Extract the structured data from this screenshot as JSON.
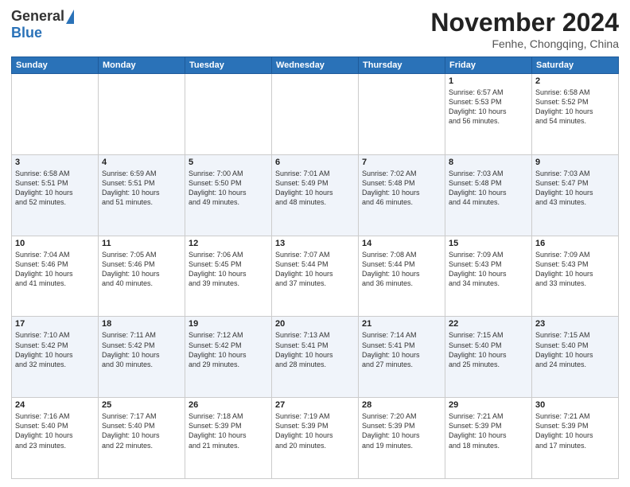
{
  "header": {
    "logo_general": "General",
    "logo_blue": "Blue",
    "month_title": "November 2024",
    "location": "Fenhe, Chongqing, China"
  },
  "calendar": {
    "days_of_week": [
      "Sunday",
      "Monday",
      "Tuesday",
      "Wednesday",
      "Thursday",
      "Friday",
      "Saturday"
    ],
    "weeks": [
      [
        {
          "day": "",
          "info": ""
        },
        {
          "day": "",
          "info": ""
        },
        {
          "day": "",
          "info": ""
        },
        {
          "day": "",
          "info": ""
        },
        {
          "day": "",
          "info": ""
        },
        {
          "day": "1",
          "info": "Sunrise: 6:57 AM\nSunset: 5:53 PM\nDaylight: 10 hours\nand 56 minutes."
        },
        {
          "day": "2",
          "info": "Sunrise: 6:58 AM\nSunset: 5:52 PM\nDaylight: 10 hours\nand 54 minutes."
        }
      ],
      [
        {
          "day": "3",
          "info": "Sunrise: 6:58 AM\nSunset: 5:51 PM\nDaylight: 10 hours\nand 52 minutes."
        },
        {
          "day": "4",
          "info": "Sunrise: 6:59 AM\nSunset: 5:51 PM\nDaylight: 10 hours\nand 51 minutes."
        },
        {
          "day": "5",
          "info": "Sunrise: 7:00 AM\nSunset: 5:50 PM\nDaylight: 10 hours\nand 49 minutes."
        },
        {
          "day": "6",
          "info": "Sunrise: 7:01 AM\nSunset: 5:49 PM\nDaylight: 10 hours\nand 48 minutes."
        },
        {
          "day": "7",
          "info": "Sunrise: 7:02 AM\nSunset: 5:48 PM\nDaylight: 10 hours\nand 46 minutes."
        },
        {
          "day": "8",
          "info": "Sunrise: 7:03 AM\nSunset: 5:48 PM\nDaylight: 10 hours\nand 44 minutes."
        },
        {
          "day": "9",
          "info": "Sunrise: 7:03 AM\nSunset: 5:47 PM\nDaylight: 10 hours\nand 43 minutes."
        }
      ],
      [
        {
          "day": "10",
          "info": "Sunrise: 7:04 AM\nSunset: 5:46 PM\nDaylight: 10 hours\nand 41 minutes."
        },
        {
          "day": "11",
          "info": "Sunrise: 7:05 AM\nSunset: 5:46 PM\nDaylight: 10 hours\nand 40 minutes."
        },
        {
          "day": "12",
          "info": "Sunrise: 7:06 AM\nSunset: 5:45 PM\nDaylight: 10 hours\nand 39 minutes."
        },
        {
          "day": "13",
          "info": "Sunrise: 7:07 AM\nSunset: 5:44 PM\nDaylight: 10 hours\nand 37 minutes."
        },
        {
          "day": "14",
          "info": "Sunrise: 7:08 AM\nSunset: 5:44 PM\nDaylight: 10 hours\nand 36 minutes."
        },
        {
          "day": "15",
          "info": "Sunrise: 7:09 AM\nSunset: 5:43 PM\nDaylight: 10 hours\nand 34 minutes."
        },
        {
          "day": "16",
          "info": "Sunrise: 7:09 AM\nSunset: 5:43 PM\nDaylight: 10 hours\nand 33 minutes."
        }
      ],
      [
        {
          "day": "17",
          "info": "Sunrise: 7:10 AM\nSunset: 5:42 PM\nDaylight: 10 hours\nand 32 minutes."
        },
        {
          "day": "18",
          "info": "Sunrise: 7:11 AM\nSunset: 5:42 PM\nDaylight: 10 hours\nand 30 minutes."
        },
        {
          "day": "19",
          "info": "Sunrise: 7:12 AM\nSunset: 5:42 PM\nDaylight: 10 hours\nand 29 minutes."
        },
        {
          "day": "20",
          "info": "Sunrise: 7:13 AM\nSunset: 5:41 PM\nDaylight: 10 hours\nand 28 minutes."
        },
        {
          "day": "21",
          "info": "Sunrise: 7:14 AM\nSunset: 5:41 PM\nDaylight: 10 hours\nand 27 minutes."
        },
        {
          "day": "22",
          "info": "Sunrise: 7:15 AM\nSunset: 5:40 PM\nDaylight: 10 hours\nand 25 minutes."
        },
        {
          "day": "23",
          "info": "Sunrise: 7:15 AM\nSunset: 5:40 PM\nDaylight: 10 hours\nand 24 minutes."
        }
      ],
      [
        {
          "day": "24",
          "info": "Sunrise: 7:16 AM\nSunset: 5:40 PM\nDaylight: 10 hours\nand 23 minutes."
        },
        {
          "day": "25",
          "info": "Sunrise: 7:17 AM\nSunset: 5:40 PM\nDaylight: 10 hours\nand 22 minutes."
        },
        {
          "day": "26",
          "info": "Sunrise: 7:18 AM\nSunset: 5:39 PM\nDaylight: 10 hours\nand 21 minutes."
        },
        {
          "day": "27",
          "info": "Sunrise: 7:19 AM\nSunset: 5:39 PM\nDaylight: 10 hours\nand 20 minutes."
        },
        {
          "day": "28",
          "info": "Sunrise: 7:20 AM\nSunset: 5:39 PM\nDaylight: 10 hours\nand 19 minutes."
        },
        {
          "day": "29",
          "info": "Sunrise: 7:21 AM\nSunset: 5:39 PM\nDaylight: 10 hours\nand 18 minutes."
        },
        {
          "day": "30",
          "info": "Sunrise: 7:21 AM\nSunset: 5:39 PM\nDaylight: 10 hours\nand 17 minutes."
        }
      ]
    ]
  }
}
